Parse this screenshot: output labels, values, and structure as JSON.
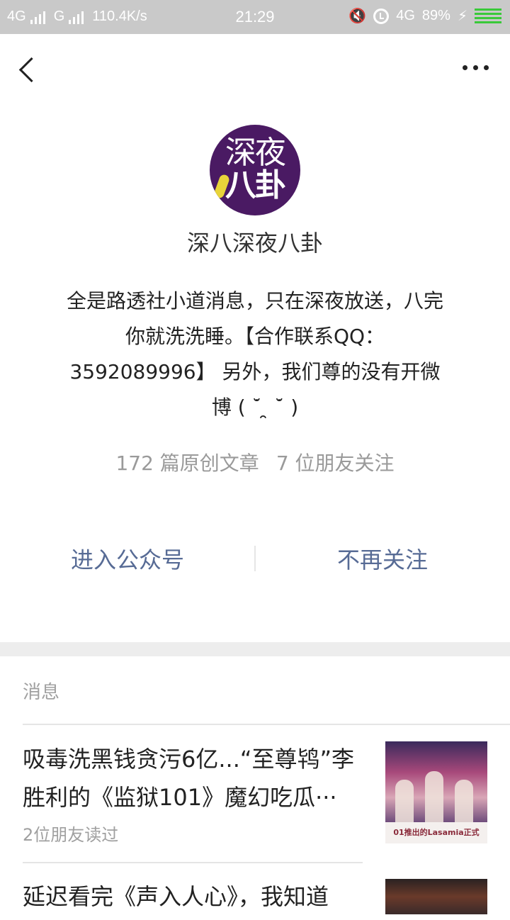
{
  "status_bar": {
    "network_left": "4G",
    "network_mid": "G",
    "speed": "110.4K/s",
    "time": "21:29",
    "network_right": "4G",
    "battery": "89%"
  },
  "account": {
    "avatar_line1": "深夜",
    "avatar_line2": "八卦",
    "name": "深八深夜八卦",
    "description": "全是路透社小道消息，只在深夜放送，八完你就洗洗睡。【合作联系QQ：3592089996】 另外，我们尊的没有开微博 ( ˙̆ ̯ ˙̆ )",
    "stats_articles": "172 篇原创文章",
    "stats_friends": "7 位朋友关注"
  },
  "actions": {
    "enter": "进入公众号",
    "unfollow": "不再关注"
  },
  "messages": {
    "section_label": "消息",
    "items": [
      {
        "title": "吸毒洗黑钱贪污6亿...“至尊鸨”李胜利的《监狱101》魔幻吃瓜···",
        "meta": "2位朋友读过",
        "thumb_caption": "01推出的Lasamia正式"
      },
      {
        "title": "延迟看完《声入人心》，我知道",
        "meta": ""
      }
    ]
  },
  "icons": {
    "back": "chevron-left-icon",
    "more": "more-dots-icon"
  },
  "colors": {
    "link": "#576b95",
    "avatar_bg": "#4a1a63",
    "muted": "#a0a0a0"
  }
}
